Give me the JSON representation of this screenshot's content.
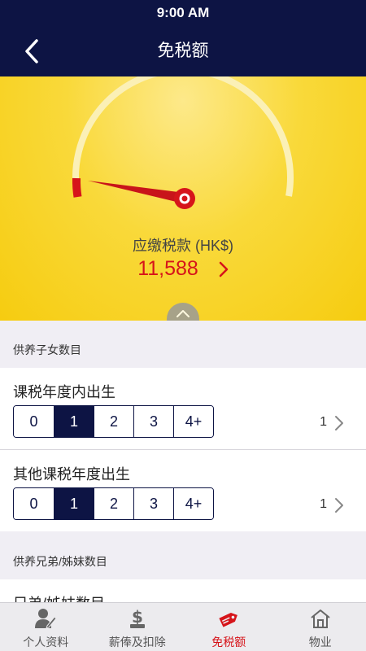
{
  "status_bar": {
    "time": "9:00 AM"
  },
  "header": {
    "title": "免税额",
    "back_icon": "chevron-left-icon"
  },
  "gauge": {
    "label": "应缴税款 (HK$)",
    "value": "11,588",
    "level_fraction": 0.0,
    "colors": {
      "arc": "#fbf0b6",
      "needle": "#d6141a",
      "redzone": "#d6141a"
    }
  },
  "children_section": {
    "header": "供养子女数目",
    "rows": [
      {
        "title": "课税年度内出生",
        "options": [
          "0",
          "1",
          "2",
          "3",
          "4+"
        ],
        "selected": "1",
        "value": "1"
      },
      {
        "title": "其他课税年度出生",
        "options": [
          "0",
          "1",
          "2",
          "3",
          "4+"
        ],
        "selected": "1",
        "value": "1"
      }
    ]
  },
  "siblings_section": {
    "header": "供养兄弟/姊妹数目",
    "row_title": "兄弟/姊妹数目"
  },
  "tab_bar": {
    "tabs": [
      {
        "label": "个人资料",
        "icon": "person-edit-icon",
        "active": false
      },
      {
        "label": "薪俸及扣除",
        "icon": "dollar-doc-icon",
        "active": false
      },
      {
        "label": "免税额",
        "icon": "tax-tag-icon",
        "active": true
      },
      {
        "label": "物业",
        "icon": "house-icon",
        "active": false
      }
    ]
  },
  "colors": {
    "navy": "#0d1444",
    "accent_red": "#d6141a",
    "hero_yellow": "#f9d93a"
  }
}
